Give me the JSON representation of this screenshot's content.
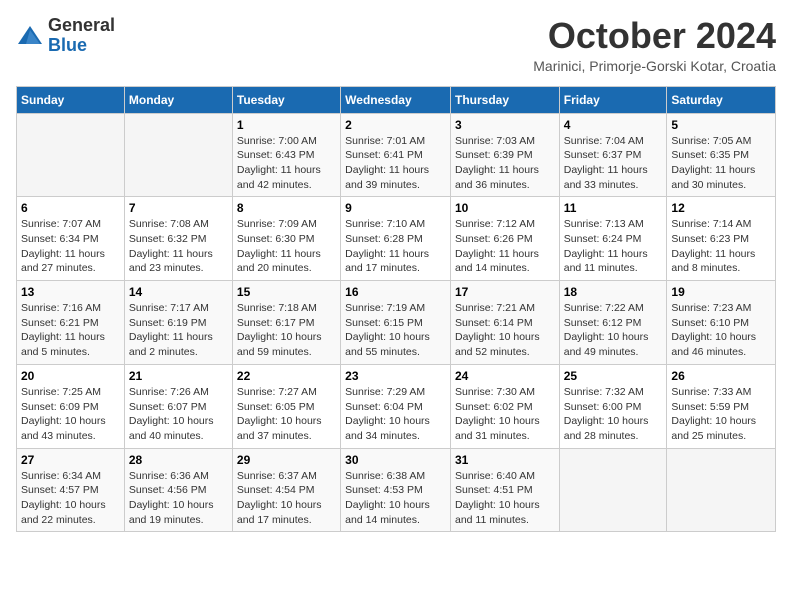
{
  "logo": {
    "general": "General",
    "blue": "Blue"
  },
  "header": {
    "title": "October 2024",
    "subtitle": "Marinici, Primorje-Gorski Kotar, Croatia"
  },
  "weekdays": [
    "Sunday",
    "Monday",
    "Tuesday",
    "Wednesday",
    "Thursday",
    "Friday",
    "Saturday"
  ],
  "weeks": [
    [
      {
        "day": "",
        "sunrise": "",
        "sunset": "",
        "daylight": ""
      },
      {
        "day": "",
        "sunrise": "",
        "sunset": "",
        "daylight": ""
      },
      {
        "day": "1",
        "sunrise": "Sunrise: 7:00 AM",
        "sunset": "Sunset: 6:43 PM",
        "daylight": "Daylight: 11 hours and 42 minutes."
      },
      {
        "day": "2",
        "sunrise": "Sunrise: 7:01 AM",
        "sunset": "Sunset: 6:41 PM",
        "daylight": "Daylight: 11 hours and 39 minutes."
      },
      {
        "day": "3",
        "sunrise": "Sunrise: 7:03 AM",
        "sunset": "Sunset: 6:39 PM",
        "daylight": "Daylight: 11 hours and 36 minutes."
      },
      {
        "day": "4",
        "sunrise": "Sunrise: 7:04 AM",
        "sunset": "Sunset: 6:37 PM",
        "daylight": "Daylight: 11 hours and 33 minutes."
      },
      {
        "day": "5",
        "sunrise": "Sunrise: 7:05 AM",
        "sunset": "Sunset: 6:35 PM",
        "daylight": "Daylight: 11 hours and 30 minutes."
      }
    ],
    [
      {
        "day": "6",
        "sunrise": "Sunrise: 7:07 AM",
        "sunset": "Sunset: 6:34 PM",
        "daylight": "Daylight: 11 hours and 27 minutes."
      },
      {
        "day": "7",
        "sunrise": "Sunrise: 7:08 AM",
        "sunset": "Sunset: 6:32 PM",
        "daylight": "Daylight: 11 hours and 23 minutes."
      },
      {
        "day": "8",
        "sunrise": "Sunrise: 7:09 AM",
        "sunset": "Sunset: 6:30 PM",
        "daylight": "Daylight: 11 hours and 20 minutes."
      },
      {
        "day": "9",
        "sunrise": "Sunrise: 7:10 AM",
        "sunset": "Sunset: 6:28 PM",
        "daylight": "Daylight: 11 hours and 17 minutes."
      },
      {
        "day": "10",
        "sunrise": "Sunrise: 7:12 AM",
        "sunset": "Sunset: 6:26 PM",
        "daylight": "Daylight: 11 hours and 14 minutes."
      },
      {
        "day": "11",
        "sunrise": "Sunrise: 7:13 AM",
        "sunset": "Sunset: 6:24 PM",
        "daylight": "Daylight: 11 hours and 11 minutes."
      },
      {
        "day": "12",
        "sunrise": "Sunrise: 7:14 AM",
        "sunset": "Sunset: 6:23 PM",
        "daylight": "Daylight: 11 hours and 8 minutes."
      }
    ],
    [
      {
        "day": "13",
        "sunrise": "Sunrise: 7:16 AM",
        "sunset": "Sunset: 6:21 PM",
        "daylight": "Daylight: 11 hours and 5 minutes."
      },
      {
        "day": "14",
        "sunrise": "Sunrise: 7:17 AM",
        "sunset": "Sunset: 6:19 PM",
        "daylight": "Daylight: 11 hours and 2 minutes."
      },
      {
        "day": "15",
        "sunrise": "Sunrise: 7:18 AM",
        "sunset": "Sunset: 6:17 PM",
        "daylight": "Daylight: 10 hours and 59 minutes."
      },
      {
        "day": "16",
        "sunrise": "Sunrise: 7:19 AM",
        "sunset": "Sunset: 6:15 PM",
        "daylight": "Daylight: 10 hours and 55 minutes."
      },
      {
        "day": "17",
        "sunrise": "Sunrise: 7:21 AM",
        "sunset": "Sunset: 6:14 PM",
        "daylight": "Daylight: 10 hours and 52 minutes."
      },
      {
        "day": "18",
        "sunrise": "Sunrise: 7:22 AM",
        "sunset": "Sunset: 6:12 PM",
        "daylight": "Daylight: 10 hours and 49 minutes."
      },
      {
        "day": "19",
        "sunrise": "Sunrise: 7:23 AM",
        "sunset": "Sunset: 6:10 PM",
        "daylight": "Daylight: 10 hours and 46 minutes."
      }
    ],
    [
      {
        "day": "20",
        "sunrise": "Sunrise: 7:25 AM",
        "sunset": "Sunset: 6:09 PM",
        "daylight": "Daylight: 10 hours and 43 minutes."
      },
      {
        "day": "21",
        "sunrise": "Sunrise: 7:26 AM",
        "sunset": "Sunset: 6:07 PM",
        "daylight": "Daylight: 10 hours and 40 minutes."
      },
      {
        "day": "22",
        "sunrise": "Sunrise: 7:27 AM",
        "sunset": "Sunset: 6:05 PM",
        "daylight": "Daylight: 10 hours and 37 minutes."
      },
      {
        "day": "23",
        "sunrise": "Sunrise: 7:29 AM",
        "sunset": "Sunset: 6:04 PM",
        "daylight": "Daylight: 10 hours and 34 minutes."
      },
      {
        "day": "24",
        "sunrise": "Sunrise: 7:30 AM",
        "sunset": "Sunset: 6:02 PM",
        "daylight": "Daylight: 10 hours and 31 minutes."
      },
      {
        "day": "25",
        "sunrise": "Sunrise: 7:32 AM",
        "sunset": "Sunset: 6:00 PM",
        "daylight": "Daylight: 10 hours and 28 minutes."
      },
      {
        "day": "26",
        "sunrise": "Sunrise: 7:33 AM",
        "sunset": "Sunset: 5:59 PM",
        "daylight": "Daylight: 10 hours and 25 minutes."
      }
    ],
    [
      {
        "day": "27",
        "sunrise": "Sunrise: 6:34 AM",
        "sunset": "Sunset: 4:57 PM",
        "daylight": "Daylight: 10 hours and 22 minutes."
      },
      {
        "day": "28",
        "sunrise": "Sunrise: 6:36 AM",
        "sunset": "Sunset: 4:56 PM",
        "daylight": "Daylight: 10 hours and 19 minutes."
      },
      {
        "day": "29",
        "sunrise": "Sunrise: 6:37 AM",
        "sunset": "Sunset: 4:54 PM",
        "daylight": "Daylight: 10 hours and 17 minutes."
      },
      {
        "day": "30",
        "sunrise": "Sunrise: 6:38 AM",
        "sunset": "Sunset: 4:53 PM",
        "daylight": "Daylight: 10 hours and 14 minutes."
      },
      {
        "day": "31",
        "sunrise": "Sunrise: 6:40 AM",
        "sunset": "Sunset: 4:51 PM",
        "daylight": "Daylight: 10 hours and 11 minutes."
      },
      {
        "day": "",
        "sunrise": "",
        "sunset": "",
        "daylight": ""
      },
      {
        "day": "",
        "sunrise": "",
        "sunset": "",
        "daylight": ""
      }
    ]
  ]
}
